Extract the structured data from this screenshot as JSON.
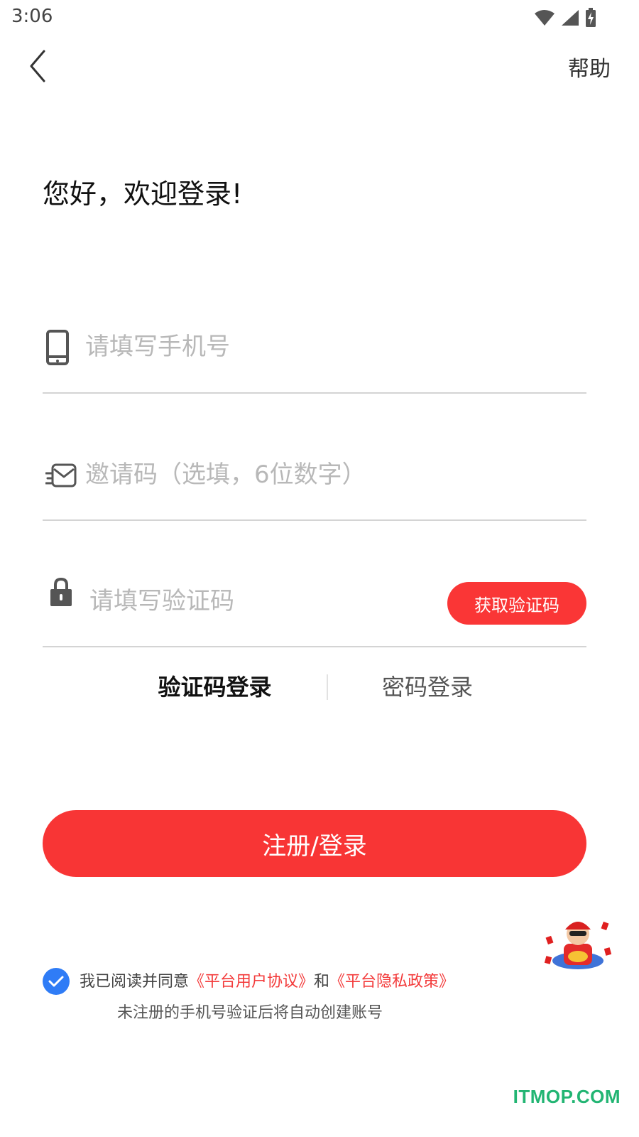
{
  "status_bar": {
    "time": "3:06",
    "icons": [
      "wifi-icon",
      "cellular-signal-icon",
      "battery-charging-icon"
    ]
  },
  "nav": {
    "back_icon": "chevron-left-icon",
    "help_label": "帮助"
  },
  "welcome_text": "您好，欢迎登录!",
  "form": {
    "phone": {
      "icon": "mobile-phone-icon",
      "value": "",
      "placeholder": "请填写手机号"
    },
    "invite": {
      "icon": "invite-mail-icon",
      "value": "",
      "placeholder": "邀请码（选填，6位数字）"
    },
    "code": {
      "icon": "lock-icon",
      "value": "",
      "placeholder": "请填写验证码",
      "button_label": "获取验证码"
    }
  },
  "login_modes": {
    "active": "验证码登录",
    "sms_label": "验证码登录",
    "password_label": "密码登录"
  },
  "submit_label": "注册/登录",
  "agreement": {
    "checked": true,
    "prefix": "我已阅读并同意",
    "user_agreement": "《平台用户协议》",
    "conjunction": "和",
    "privacy_policy": "《平台隐私政策》",
    "note": "未注册的手机号验证后将自动创建账号"
  },
  "watermark": "ITMOP.COM",
  "colors": {
    "accent": "#f83535",
    "checkbox": "#2f7cf6",
    "link": "#f33b3b",
    "watermark": "#22b573"
  }
}
